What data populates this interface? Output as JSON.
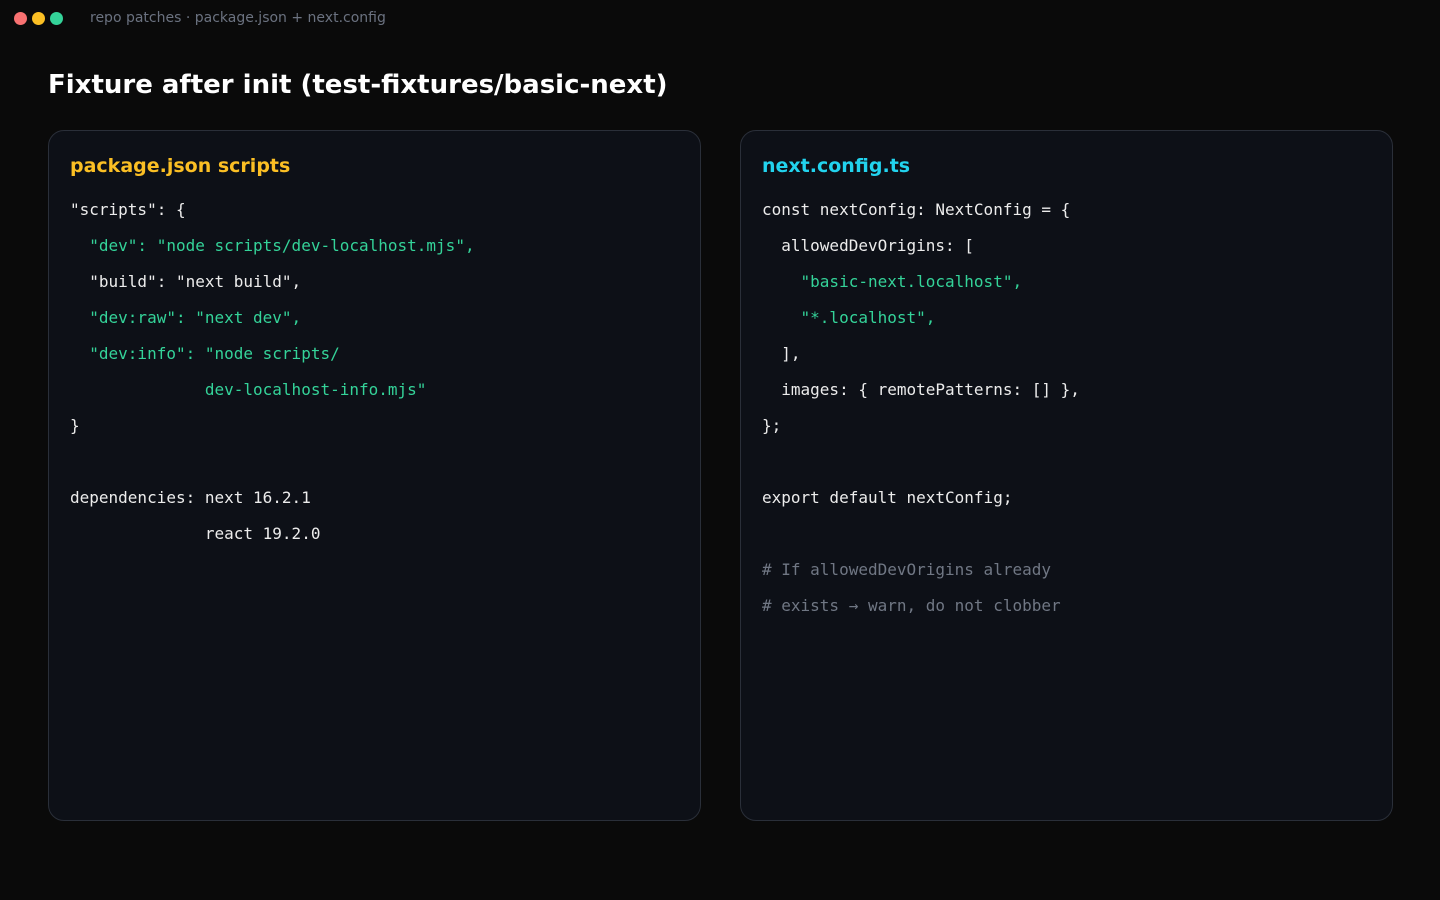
{
  "window": {
    "title": "repo patches · package.json + next.config",
    "controls": [
      "close",
      "minimize",
      "maximize"
    ]
  },
  "colors": {
    "background": "#0a0a0a",
    "panel": "#0d1017",
    "accent_package": "#fbbf24",
    "accent_config": "#22d3ee",
    "code_text": "#ececec",
    "code_string": "#34d399",
    "code_comment": "#707784"
  },
  "page": {
    "title": "Fixture after init (test-fixtures/basic-next)"
  },
  "panels": [
    {
      "title": "package.json scripts",
      "lines": [
        {
          "text": "\"scripts\": {",
          "style": "white"
        },
        {
          "text": "  \"dev\": \"node scripts/dev-localhost.mjs\",",
          "style": "green"
        },
        {
          "text": "  \"build\": \"next build\",",
          "style": "white"
        },
        {
          "text": "  \"dev:raw\": \"next dev\",",
          "style": "green"
        },
        {
          "text": "  \"dev:info\": \"node scripts/",
          "style": "green"
        },
        {
          "text": "              dev-localhost-info.mjs\"",
          "style": "green"
        },
        {
          "text": "}",
          "style": "white"
        },
        {
          "text": "",
          "style": "white"
        },
        {
          "text": "dependencies: next 16.2.1",
          "style": "white"
        },
        {
          "text": "              react 19.2.0",
          "style": "white"
        }
      ]
    },
    {
      "title": "next.config.ts",
      "lines": [
        {
          "text": "const nextConfig: NextConfig = {",
          "style": "white"
        },
        {
          "text": "  allowedDevOrigins: [",
          "style": "white"
        },
        {
          "text": "    \"basic-next.localhost\",",
          "style": "green"
        },
        {
          "text": "    \"*.localhost\",",
          "style": "green"
        },
        {
          "text": "  ],",
          "style": "white"
        },
        {
          "text": "  images: { remotePatterns: [] },",
          "style": "white"
        },
        {
          "text": "};",
          "style": "white"
        },
        {
          "text": "",
          "style": "white"
        },
        {
          "text": "export default nextConfig;",
          "style": "white"
        },
        {
          "text": "",
          "style": "white"
        },
        {
          "text": "# If allowedDevOrigins already",
          "style": "gray"
        },
        {
          "text": "# exists → warn, do not clobber",
          "style": "gray"
        }
      ]
    }
  ]
}
